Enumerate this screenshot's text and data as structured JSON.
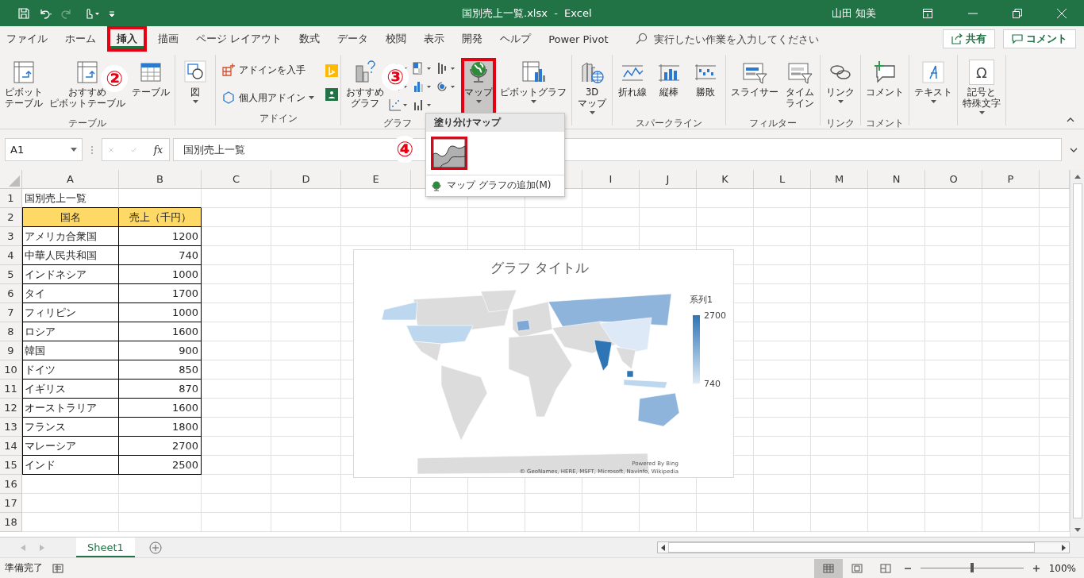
{
  "window": {
    "title": "国別売上一覧.xlsx  -  Excel",
    "user": "山田 知美"
  },
  "tabs": [
    {
      "label": "ファイル",
      "selected": false,
      "highlighted": false
    },
    {
      "label": "ホーム",
      "selected": false,
      "highlighted": false
    },
    {
      "label": "挿入",
      "selected": true,
      "highlighted": true
    },
    {
      "label": "描画",
      "selected": false,
      "highlighted": false
    },
    {
      "label": "ページ レイアウト",
      "selected": false,
      "highlighted": false
    },
    {
      "label": "数式",
      "selected": false,
      "highlighted": false
    },
    {
      "label": "データ",
      "selected": false,
      "highlighted": false
    },
    {
      "label": "校閲",
      "selected": false,
      "highlighted": false
    },
    {
      "label": "表示",
      "selected": false,
      "highlighted": false
    },
    {
      "label": "開発",
      "selected": false,
      "highlighted": false
    },
    {
      "label": "ヘルプ",
      "selected": false,
      "highlighted": false
    },
    {
      "label": "Power Pivot",
      "selected": false,
      "highlighted": false
    }
  ],
  "search": {
    "placeholder": "実行したい作業を入力してください"
  },
  "share_button": "共有",
  "comment_button": "コメント",
  "ribbon": {
    "groups": [
      {
        "label": "テーブル",
        "items": [
          {
            "kind": "large",
            "lines": [
              "ピボット",
              "テーブル"
            ],
            "dropdown": false,
            "pressed": false,
            "highlighted": false
          },
          {
            "kind": "large",
            "lines": [
              "おすすめ",
              "ピボットテーブル"
            ],
            "dropdown": false,
            "pressed": false,
            "highlighted": false
          },
          {
            "kind": "large",
            "lines": [
              "テーブル"
            ],
            "dropdown": false,
            "pressed": false,
            "highlighted": false
          }
        ]
      },
      {
        "items": [
          {
            "kind": "large",
            "lines": [
              "図"
            ],
            "dropdown": true,
            "pressed": false,
            "highlighted": false
          }
        ]
      },
      {
        "label": "アドイン",
        "items": [
          {
            "kind": "small",
            "label": "アドインを入手",
            "dropdown": false,
            "pressed": false,
            "highlighted": false
          },
          {
            "kind": "small",
            "label": "個人用アドイン",
            "dropdown": true,
            "pressed": false,
            "highlighted": false
          },
          {
            "kind": "icon_column"
          }
        ]
      },
      {
        "label": "グラフ",
        "items": [
          {
            "kind": "large",
            "lines": [
              "おすすめ",
              "グラフ"
            ],
            "dropdown": false,
            "pressed": false,
            "highlighted": false
          },
          {
            "kind": "icon_grid"
          },
          {
            "kind": "large",
            "lines": [
              "マップ"
            ],
            "dropdown": true,
            "pressed": true,
            "highlighted": true
          },
          {
            "kind": "large",
            "lines": [
              "ピボットグラフ"
            ],
            "dropdown": true,
            "pressed": false,
            "highlighted": false
          }
        ]
      },
      {
        "items": [
          {
            "kind": "large",
            "lines": [
              "3D",
              "マップ"
            ],
            "dropdown": true,
            "pressed": false,
            "highlighted": false
          }
        ]
      },
      {
        "label": "スパークライン",
        "items": [
          {
            "kind": "large",
            "lines": [
              "折れ線"
            ],
            "dropdown": false,
            "pressed": false,
            "highlighted": false
          },
          {
            "kind": "large",
            "lines": [
              "縦棒"
            ],
            "dropdown": false,
            "pressed": false,
            "highlighted": false
          },
          {
            "kind": "large",
            "lines": [
              "勝敗"
            ],
            "dropdown": false,
            "pressed": false,
            "highlighted": false
          }
        ]
      },
      {
        "label": "フィルター",
        "items": [
          {
            "kind": "large",
            "lines": [
              "スライサー"
            ],
            "dropdown": false,
            "pressed": false,
            "highlighted": false
          },
          {
            "kind": "large",
            "lines": [
              "タイム",
              "ライン"
            ],
            "dropdown": false,
            "pressed": false,
            "highlighted": false
          }
        ]
      },
      {
        "label": "リンク",
        "items": [
          {
            "kind": "large",
            "lines": [
              "リンク"
            ],
            "dropdown": true,
            "pressed": false,
            "highlighted": false
          }
        ]
      },
      {
        "label": "コメント",
        "items": [
          {
            "kind": "large",
            "lines": [
              "コメント"
            ],
            "dropdown": false,
            "pressed": false,
            "highlighted": false
          }
        ]
      },
      {
        "items": [
          {
            "kind": "large",
            "lines": [
              "テキスト"
            ],
            "dropdown": true,
            "pressed": false,
            "highlighted": false
          }
        ]
      },
      {
        "items": [
          {
            "kind": "large",
            "lines": [
              "記号と",
              "特殊文字"
            ],
            "icon_text": "Ω",
            "dropdown": true,
            "pressed": false,
            "highlighted": false
          }
        ]
      }
    ]
  },
  "formula_bar": {
    "name_box": "A1",
    "function_label": "fx",
    "value": "国別売上一覧"
  },
  "sheet": {
    "columns": [
      "A",
      "B",
      "C",
      "D",
      "E",
      null,
      null,
      null,
      "I",
      "J",
      "K",
      "L",
      "M",
      "N",
      "O",
      "P"
    ],
    "rows": [
      {
        "number": "1",
        "kind": "title",
        "cells": [
          "国別売上一覧"
        ]
      },
      {
        "number": "2",
        "kind": "header",
        "cells": [
          "国名",
          "売上（千円）"
        ]
      },
      {
        "number": "3",
        "kind": "data",
        "cells": [
          "アメリカ合衆国",
          "1200"
        ]
      },
      {
        "number": "4",
        "kind": "data",
        "cells": [
          "中華人民共和国",
          "740"
        ]
      },
      {
        "number": "5",
        "kind": "data",
        "cells": [
          "インドネシア",
          "1000"
        ]
      },
      {
        "number": "6",
        "kind": "data",
        "cells": [
          "タイ",
          "1700"
        ]
      },
      {
        "number": "7",
        "kind": "data",
        "cells": [
          "フィリピン",
          "1000"
        ]
      },
      {
        "number": "8",
        "kind": "data",
        "cells": [
          "ロシア",
          "1600"
        ]
      },
      {
        "number": "9",
        "kind": "data",
        "cells": [
          "韓国",
          "900"
        ]
      },
      {
        "number": "10",
        "kind": "data",
        "cells": [
          "ドイツ",
          "850"
        ]
      },
      {
        "number": "11",
        "kind": "data",
        "cells": [
          "イギリス",
          "870"
        ]
      },
      {
        "number": "12",
        "kind": "data",
        "cells": [
          "オーストラリア",
          "1600"
        ]
      },
      {
        "number": "13",
        "kind": "data",
        "cells": [
          "フランス",
          "1800"
        ]
      },
      {
        "number": "14",
        "kind": "data",
        "cells": [
          "マレーシア",
          "2700"
        ]
      },
      {
        "number": "15",
        "kind": "data",
        "cells": [
          "インド",
          "2500"
        ]
      },
      {
        "number": "16",
        "kind": "empty"
      },
      {
        "number": "17",
        "kind": "empty"
      },
      {
        "number": "18",
        "kind": "empty"
      }
    ]
  },
  "chart": {
    "title": "グラフ タイトル",
    "legend_title": "系列1",
    "legend_max": "2700",
    "legend_min": "740",
    "credit": "Powered By Bing",
    "attribution": "© GeoNames, HERE, MSFT, Microsoft, Navinfo, Wikipedia"
  },
  "map_menu": {
    "title": "塗り分けマップ",
    "gallery": [
      {
        "highlighted": true
      }
    ],
    "items": [
      {
        "label": "マップ グラフの追加(M)"
      }
    ]
  },
  "callouts": [
    {
      "label": "②"
    },
    {
      "label": "③"
    },
    {
      "label": "④"
    }
  ],
  "sheet_tabs": [
    {
      "name": "Sheet1",
      "selected": true
    }
  ],
  "status_bar": {
    "status": "準備完了",
    "views": [
      {
        "selected": true
      },
      {
        "selected": false
      },
      {
        "selected": false
      }
    ],
    "zoom": {
      "level": 0.5,
      "reading": "100%"
    }
  }
}
